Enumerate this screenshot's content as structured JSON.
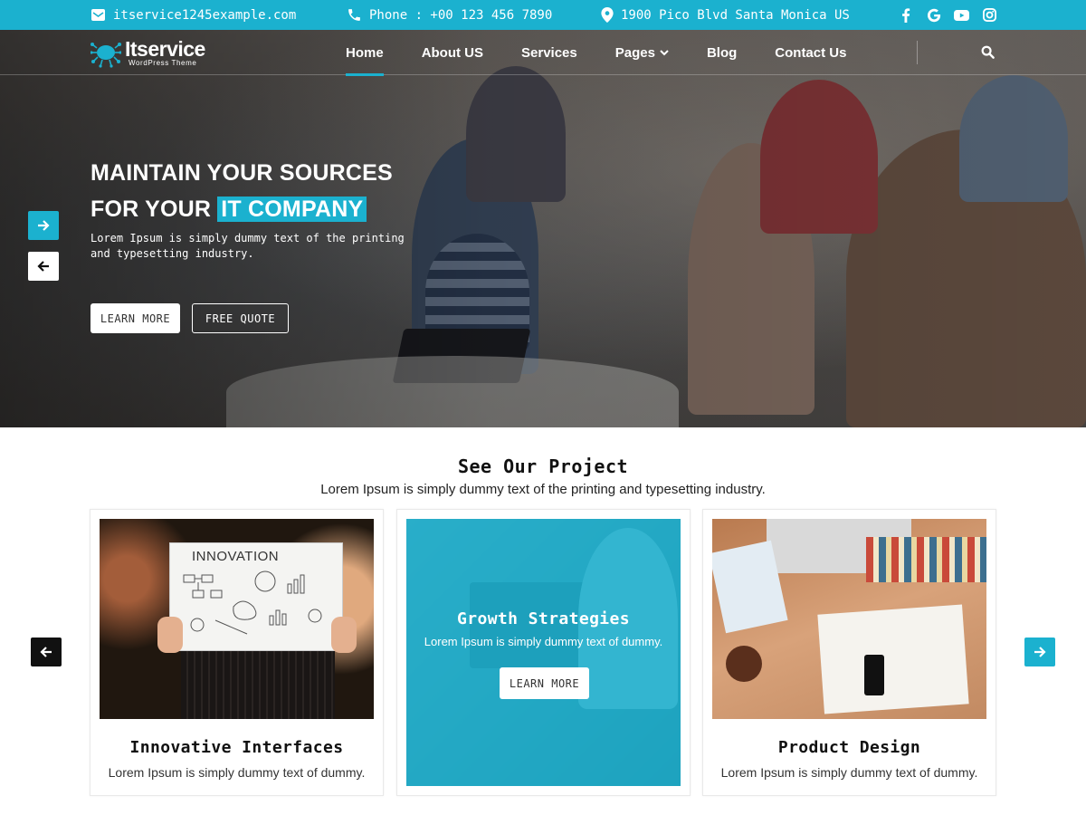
{
  "topbar": {
    "email": "itservice1245example.com",
    "phone": "Phone : +00 123 456 7890",
    "address": "1900 Pico Blvd Santa Monica US",
    "social_icons": [
      "facebook-icon",
      "google-icon",
      "youtube-icon",
      "instagram-icon"
    ]
  },
  "nav": {
    "logo_title": "Itservice",
    "logo_subtitle": "WordPress Theme",
    "items": [
      {
        "label": "Home"
      },
      {
        "label": "About US"
      },
      {
        "label": "Services"
      },
      {
        "label": "Pages"
      },
      {
        "label": "Blog"
      },
      {
        "label": "Contact Us"
      }
    ]
  },
  "hero": {
    "title_line1": "MAINTAIN YOUR SOURCES",
    "title_line2_prefix": "FOR YOUR",
    "title_line2_highlight": "IT COMPANY",
    "text": "Lorem Ipsum is simply dummy text of the printing and typesetting industry.",
    "learn_more": "LEARN MORE",
    "free_quote": "FREE QUOTE"
  },
  "projects": {
    "title": "See Our Project",
    "subtitle": "Lorem Ipsum is simply dummy text of the printing and typesetting industry.",
    "cards": [
      {
        "title": "Innovative Interfaces",
        "text": "Lorem Ipsum is simply dummy text of dummy.",
        "image_label": "INNOVATION"
      },
      {
        "title": "Growth Strategies",
        "text": "Lorem Ipsum is simply dummy text of dummy.",
        "button": "LEARN MORE"
      },
      {
        "title": "Product Design",
        "text": "Lorem Ipsum is simply dummy text of dummy."
      }
    ]
  },
  "colors": {
    "accent": "#1bb1cf",
    "dark": "#111111",
    "white": "#ffffff"
  }
}
